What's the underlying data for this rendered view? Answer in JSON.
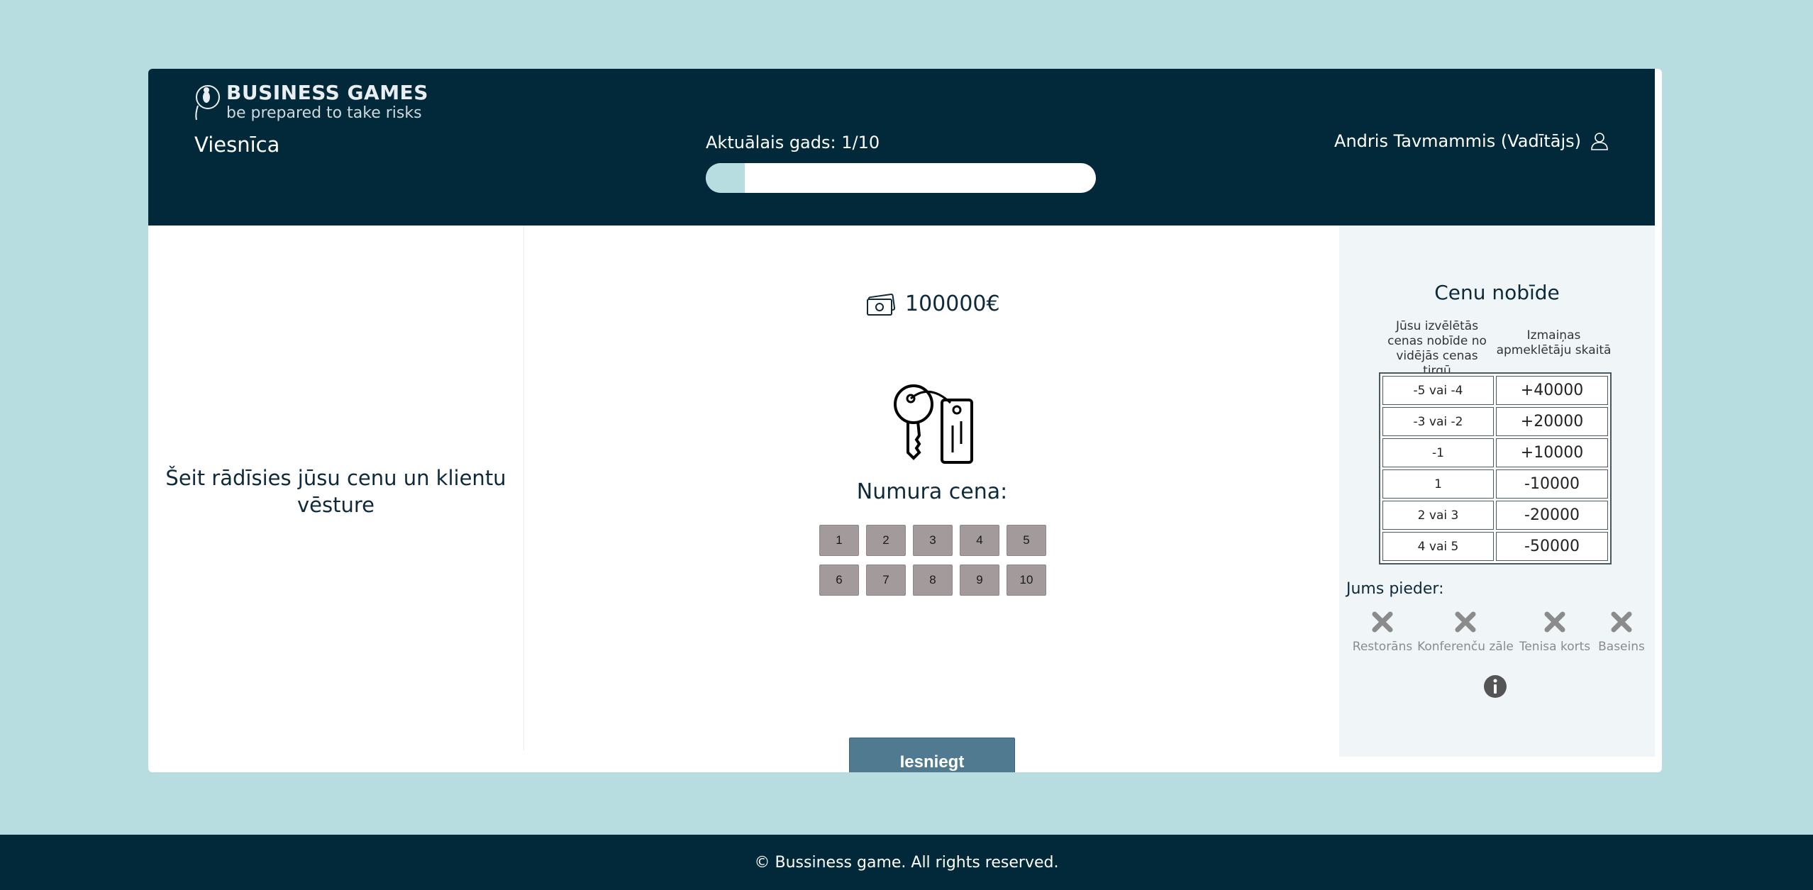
{
  "header": {
    "brand_name": "BUSINESS GAMES",
    "brand_tagline": "be prepared to take risks",
    "game_title": "Viesnīca",
    "year_label": "Aktuālais gads: 1/10",
    "year_progress": 0.1,
    "user_name": "Andris Tavmammis (Vadītājs)"
  },
  "left_panel": {
    "history_text": "Šeit rādīsies jūsu cenu un klientu vēsture"
  },
  "main": {
    "money": "100000€",
    "price_label": "Numura cena:",
    "price_options": [
      "1",
      "2",
      "3",
      "4",
      "5",
      "6",
      "7",
      "8",
      "9",
      "10"
    ],
    "submit_label": "Iesniegt"
  },
  "right_panel": {
    "title": "Cenu nobīde",
    "col1_header": "Jūsu izvēlētās cenas nobīde no vidējās cenas tirgū",
    "col2_header": "Izmaiņas apmeklētāju skaitā",
    "rows": [
      {
        "deviation": "-5 vai -4",
        "change": "+40000"
      },
      {
        "deviation": "-3 vai -2",
        "change": "+20000"
      },
      {
        "deviation": "-1",
        "change": "+10000"
      },
      {
        "deviation": "1",
        "change": "-10000"
      },
      {
        "deviation": "2 vai 3",
        "change": "-20000"
      },
      {
        "deviation": "4 vai 5",
        "change": "-50000"
      }
    ],
    "owns_label": "Jums pieder:",
    "amenities": [
      "Restorāns",
      "Konferenču zāle",
      "Tenisa korts",
      "Baseins"
    ]
  },
  "footer": {
    "copyright": "© Bussiness game. All rights reserved."
  },
  "colors": {
    "background": "#b7dde0",
    "header": "#01293a",
    "button": "#4f7a8f",
    "price_button": "#a39b9b"
  }
}
